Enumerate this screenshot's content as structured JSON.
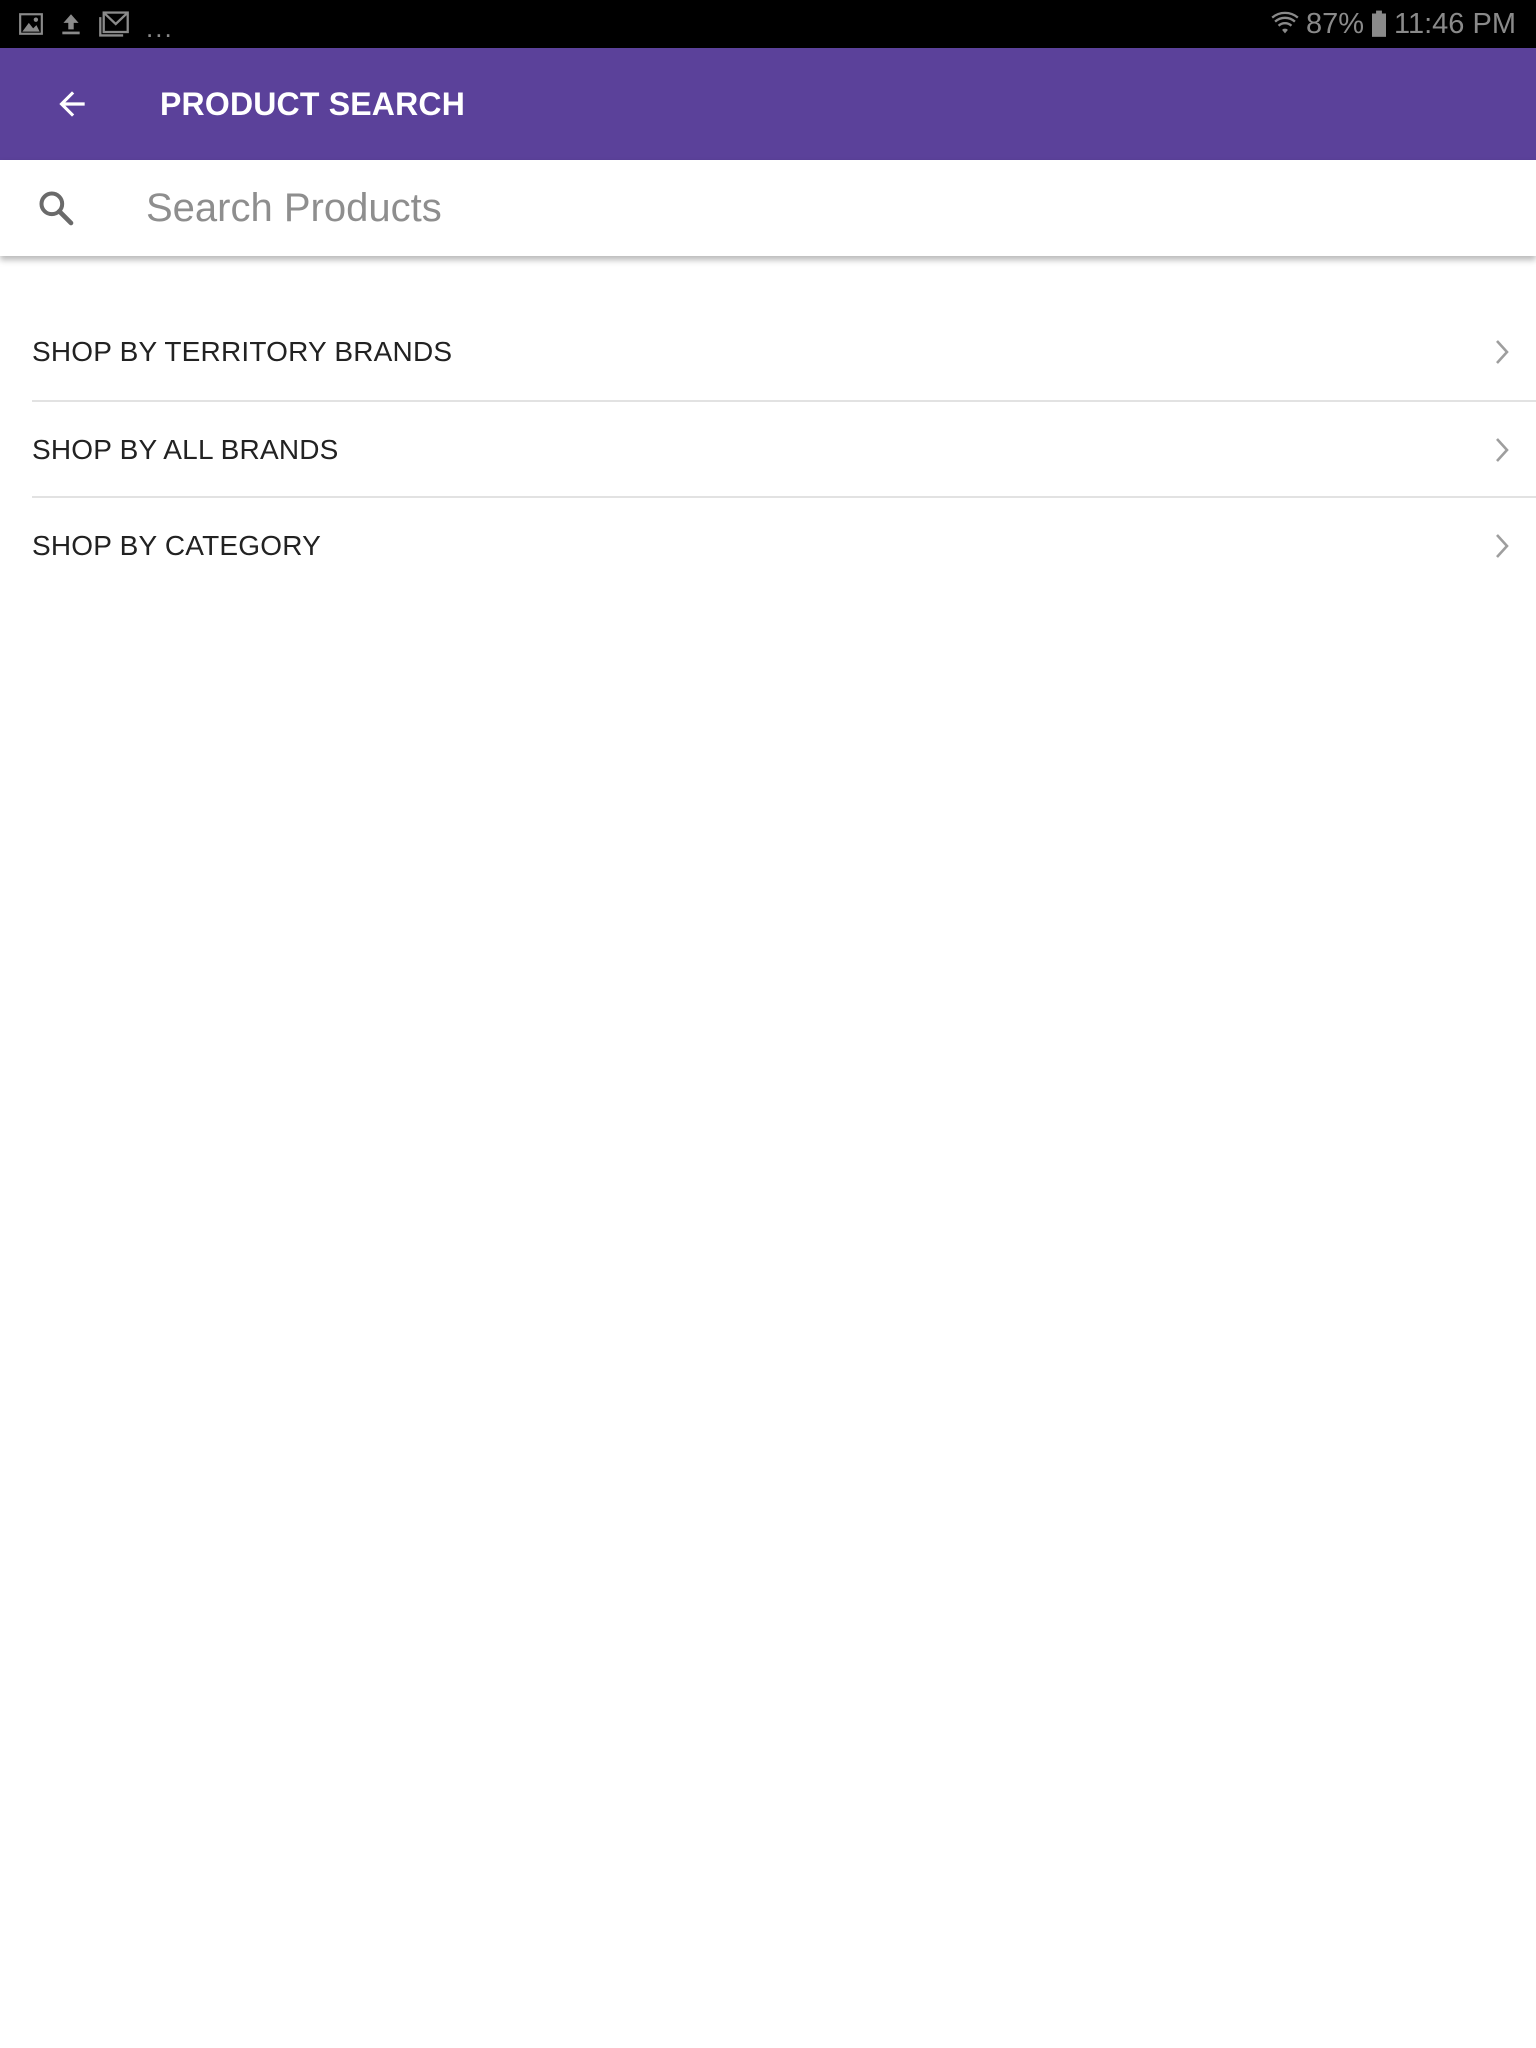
{
  "status_bar": {
    "battery": "87%",
    "time": "11:46 PM",
    "overflow": "...",
    "icons": [
      "image-icon",
      "upload-icon",
      "mail-icon",
      "wifi-icon",
      "battery-icon"
    ]
  },
  "app_bar": {
    "title": "PRODUCT SEARCH",
    "back_icon": "arrow-back-icon",
    "background": "#5b419a"
  },
  "search": {
    "placeholder": "Search Products",
    "value": "",
    "icon": "search-icon"
  },
  "menu": {
    "items": [
      {
        "label": "SHOP BY TERRITORY BRANDS",
        "icon": "chevron-right-icon"
      },
      {
        "label": "SHOP BY ALL BRANDS",
        "icon": "chevron-right-icon"
      },
      {
        "label": "SHOP BY CATEGORY",
        "icon": "chevron-right-icon"
      }
    ]
  }
}
